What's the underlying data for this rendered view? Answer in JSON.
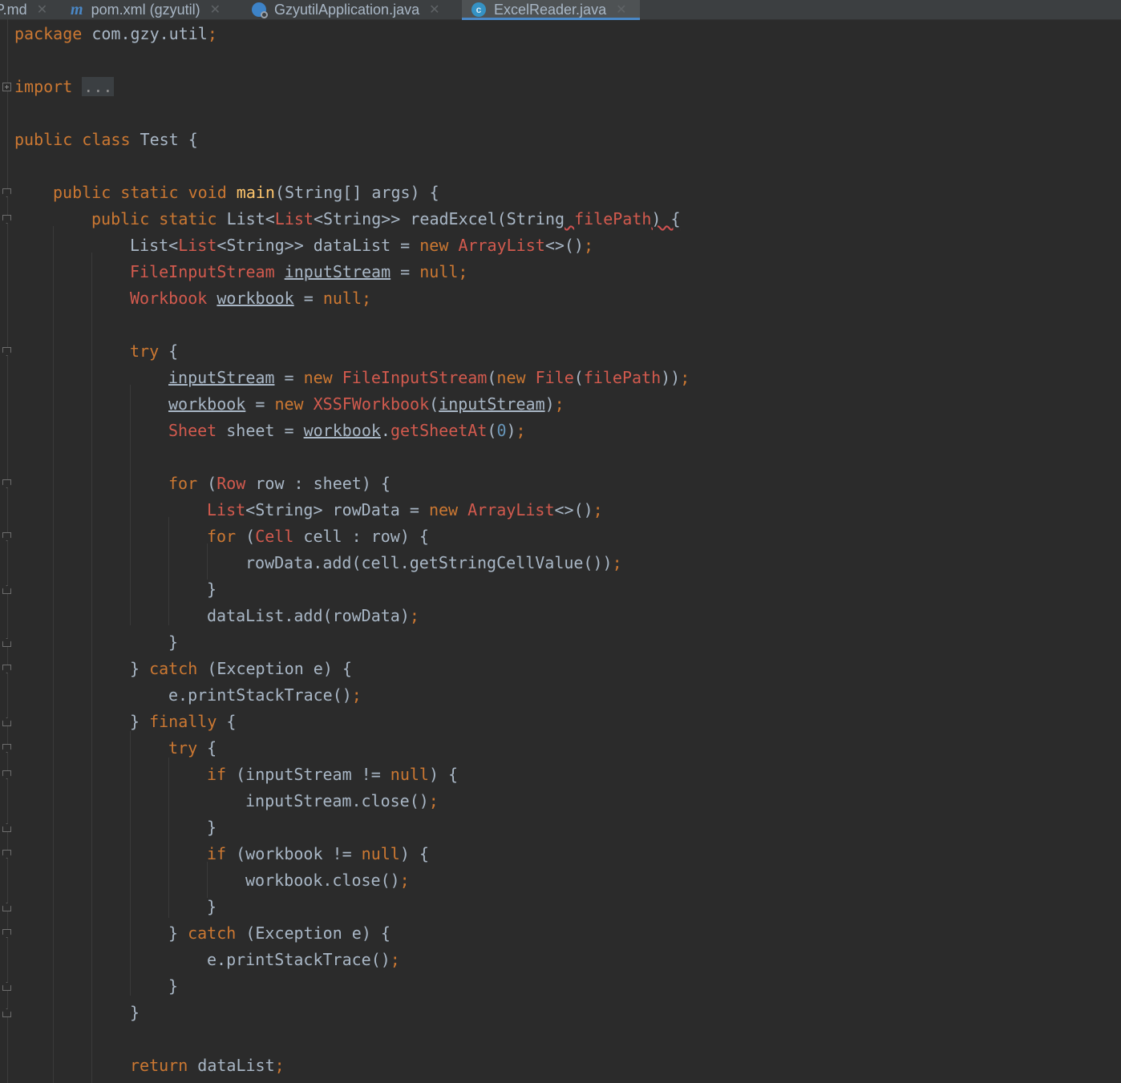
{
  "tabs": [
    {
      "label": "P.md",
      "icon": "markdown-file-icon",
      "active": false
    },
    {
      "label": "pom.xml (gzyutil)",
      "icon": "maven-icon",
      "active": false
    },
    {
      "label": "GzyutilApplication.java",
      "icon": "spring-boot-app-icon",
      "active": false
    },
    {
      "label": "ExcelReader.java",
      "icon": "java-class-icon",
      "active": true
    }
  ],
  "colors": {
    "background": "#2b2b2b",
    "keyword": "#cc7832",
    "type_error": "#d25a4e",
    "method_decl": "#ffc66d",
    "number": "#6897bb",
    "default_text": "#a9b7c6",
    "active_tab_underline": "#4a88c7"
  },
  "code": {
    "l1": {
      "kw": "package",
      "rest": " com.gzy.util",
      "semi": ";"
    },
    "l2": {
      "kw": "import",
      "folded": "..."
    },
    "l3": {
      "kw": "public class",
      "name": " Test",
      "rest": " {"
    },
    "l4": {
      "kw": "public static void",
      "fn": "main",
      "rest": "(String[] args) {"
    },
    "l5": {
      "kw": "public static",
      "a": " List<",
      "ty": "List",
      "b": "<String>> readExcel(String",
      "param": "filePath",
      "c": ") {"
    },
    "l6": {
      "a": "List<",
      "ty": "List",
      "b": "<String>> dataList = ",
      "kw": "new",
      "ty2": "ArrayList",
      "c": "<>()",
      "semi": ";"
    },
    "l7": {
      "ty": "FileInputStream",
      "var": "inputStream",
      "b": " = ",
      "kw": "null",
      "semi": ";"
    },
    "l8": {
      "ty": "Workbook",
      "var": "workbook",
      "b": " = ",
      "kw": "null",
      "semi": ";"
    },
    "l9": {
      "kw": "try",
      "rest": " {"
    },
    "l10": {
      "var": "inputStream",
      "b": " = ",
      "kw": "new",
      "ty": "FileInputStream",
      "c": "(",
      "kw2": "new",
      "ty2": "File",
      "d": "(",
      "param": "filePath",
      "e": "))",
      "semi": ";"
    },
    "l11": {
      "var": "workbook",
      "b": " = ",
      "kw": "new",
      "ty": "XSSFWorkbook",
      "c": "(",
      "var2": "inputStream",
      "d": ")",
      "semi": ";"
    },
    "l12": {
      "ty": "Sheet",
      "b": " sheet = ",
      "var": "workbook",
      "c": ".",
      "ty2": "getSheetAt",
      "d": "(",
      "num": "0",
      "e": ")",
      "semi": ";"
    },
    "l13": {
      "kw": "for",
      "a": " (",
      "ty": "Row",
      "b": " row : sheet) {"
    },
    "l14": {
      "ty": "List",
      "a": "<String> rowData = ",
      "kw": "new",
      "ty2": "ArrayList",
      "b": "<>()",
      "semi": ";"
    },
    "l15": {
      "kw": "for",
      "a": " (",
      "ty": "Cell",
      "b": " cell : row) {"
    },
    "l16": {
      "a": "rowData.add(cell.getStringCellValue())",
      "semi": ";"
    },
    "l17": {
      "a": "}"
    },
    "l18": {
      "a": "dataList.add(rowData)",
      "semi": ";"
    },
    "l19": {
      "a": "}"
    },
    "l20": {
      "a": "} ",
      "kw": "catch",
      "b": " (Exception e) {"
    },
    "l21": {
      "a": "e.printStackTrace()",
      "semi": ";"
    },
    "l22": {
      "a": "} ",
      "kw": "finally",
      "b": " {"
    },
    "l23": {
      "kw": "try",
      "a": " {"
    },
    "l24": {
      "kw": "if",
      "a": " (inputStream != ",
      "kw2": "null",
      "b": ") {"
    },
    "l25": {
      "a": "inputStream.close()",
      "semi": ";"
    },
    "l26": {
      "a": "}"
    },
    "l27": {
      "kw": "if",
      "a": " (workbook != ",
      "kw2": "null",
      "b": ") {"
    },
    "l28": {
      "a": "workbook.close()",
      "semi": ";"
    },
    "l29": {
      "a": "}"
    },
    "l30": {
      "a": "} ",
      "kw": "catch",
      "b": " (Exception e) {"
    },
    "l31": {
      "a": "e.printStackTrace()",
      "semi": ";"
    },
    "l32": {
      "a": "}"
    },
    "l33": {
      "a": "}"
    },
    "l34": {
      "kw": "return",
      "a": " dataList",
      "semi": ";"
    }
  }
}
